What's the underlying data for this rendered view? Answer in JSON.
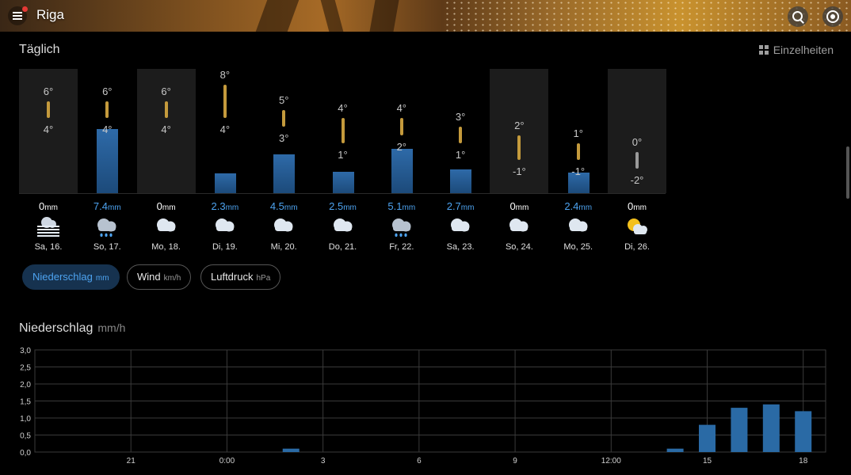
{
  "header": {
    "city": "Riga"
  },
  "daily": {
    "title": "Täglich",
    "details_label": "Einzelheiten",
    "unit": "mm",
    "days": [
      {
        "label": "Sa, 16.",
        "high": "6°",
        "low": "4°",
        "precip": "0",
        "precip_mm": 0,
        "icon": "fog-icon",
        "hi_val": 6,
        "lo_val": 4
      },
      {
        "label": "So, 17.",
        "high": "6°",
        "low": "4°",
        "precip": "7.4",
        "precip_mm": 7.4,
        "icon": "rain-cloud-icon",
        "hi_val": 6,
        "lo_val": 4
      },
      {
        "label": "Mo, 18.",
        "high": "6°",
        "low": "4°",
        "precip": "0",
        "precip_mm": 0,
        "icon": "cloud-icon",
        "hi_val": 6,
        "lo_val": 4
      },
      {
        "label": "Di, 19.",
        "high": "8°",
        "low": "4°",
        "precip": "2.3",
        "precip_mm": 2.3,
        "icon": "cloud-icon",
        "hi_val": 8,
        "lo_val": 4
      },
      {
        "label": "Mi, 20.",
        "high": "5°",
        "low": "3°",
        "precip": "4.5",
        "precip_mm": 4.5,
        "icon": "cloud-icon",
        "hi_val": 5,
        "lo_val": 3
      },
      {
        "label": "Do, 21.",
        "high": "4°",
        "low": "1°",
        "precip": "2.5",
        "precip_mm": 2.5,
        "icon": "cloud-icon",
        "hi_val": 4,
        "lo_val": 1
      },
      {
        "label": "Fr, 22.",
        "high": "4°",
        "low": "2°",
        "precip": "5.1",
        "precip_mm": 5.1,
        "icon": "rain-cloud-icon",
        "hi_val": 4,
        "lo_val": 2
      },
      {
        "label": "Sa, 23.",
        "high": "3°",
        "low": "1°",
        "precip": "2.7",
        "precip_mm": 2.7,
        "icon": "cloud-icon",
        "hi_val": 3,
        "lo_val": 1
      },
      {
        "label": "So, 24.",
        "high": "2°",
        "low": "-1°",
        "precip": "0",
        "precip_mm": 0,
        "icon": "cloud-icon",
        "hi_val": 2,
        "lo_val": -1
      },
      {
        "label": "Mo, 25.",
        "high": "1°",
        "low": "-1°",
        "precip": "2.4",
        "precip_mm": 2.4,
        "icon": "cloud-icon",
        "hi_val": 1,
        "lo_val": -1
      },
      {
        "label": "Di, 26.",
        "high": "0°",
        "low": "-2°",
        "precip": "0",
        "precip_mm": 0,
        "icon": "partly-sunny-icon",
        "hi_val": 0,
        "lo_val": -2
      }
    ]
  },
  "tabs": [
    {
      "label": "Niederschlag",
      "unit": "mm",
      "active": true
    },
    {
      "label": "Wind",
      "unit": "km/h",
      "active": false
    },
    {
      "label": "Luftdruck",
      "unit": "hPa",
      "active": false
    }
  ],
  "hourly": {
    "title": "Niederschlag",
    "unit": "mm/h"
  },
  "chart_data": {
    "type": "bar",
    "title": "Niederschlag",
    "ylabel": "mm/h",
    "ylim": [
      0,
      3.0
    ],
    "yticks": [
      "0,0",
      "0,5",
      "1,0",
      "1,5",
      "2,0",
      "2,5",
      "3,0"
    ],
    "xtick_labels": [
      "21",
      "0:00",
      "3",
      "6",
      "9",
      "12:00",
      "15",
      "18"
    ],
    "x_hours": [
      21,
      24,
      27,
      30,
      33,
      36,
      39,
      42
    ],
    "bars": [
      {
        "hour": 26,
        "value": 0.1
      },
      {
        "hour": 38,
        "value": 0.1
      },
      {
        "hour": 39,
        "value": 0.8
      },
      {
        "hour": 40,
        "value": 1.3
      },
      {
        "hour": 41,
        "value": 1.4
      },
      {
        "hour": 42,
        "value": 1.2
      }
    ],
    "bar_color": "#2a6aa5",
    "grid": true
  },
  "colors": {
    "accent": "#4da3f0",
    "temp_bar": "#c49a3c",
    "precip_bar": "#2a6aa5"
  }
}
